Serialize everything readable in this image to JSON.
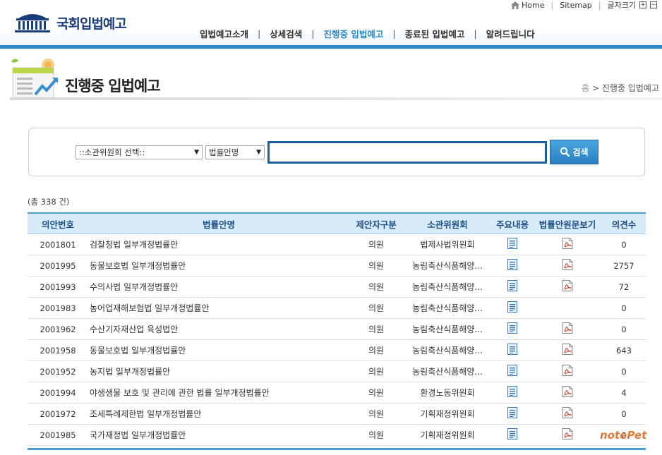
{
  "util": {
    "home": "Home",
    "sitemap": "Sitemap",
    "font_size": "글자크기",
    "plus": "+",
    "minus": "−"
  },
  "logo": {
    "text": "국회입법예고"
  },
  "nav": [
    {
      "label": "입법예고소개"
    },
    {
      "label": "상세검색"
    },
    {
      "label": "진행중 입법예고"
    },
    {
      "label": "종료된 입법예고"
    },
    {
      "label": "알려드립니다"
    }
  ],
  "page": {
    "title": "진행중 입법예고",
    "breadcrumb_home": "홈",
    "breadcrumb_sep": ">",
    "breadcrumb_current": "진행중 입법예고"
  },
  "search": {
    "committee_select": "::소관위원회 선택::",
    "field_select": "법률안명",
    "input_value": "",
    "button_label": "검색"
  },
  "count_label": "(총 338 건)",
  "table": {
    "headers": [
      "의안번호",
      "법률안명",
      "제안자구분",
      "소관위원회",
      "주요내용",
      "법률안원문보기",
      "의견수"
    ],
    "rows": [
      {
        "no": "2001801",
        "name": "검찰청법 일부개정법률안",
        "proposer": "의원",
        "committee": "법제사법위원회",
        "has_pdf": true,
        "opinions": "0"
      },
      {
        "no": "2001995",
        "name": "동물보호법 일부개정법률안",
        "proposer": "의원",
        "committee": "농림축산식품해양...",
        "has_pdf": true,
        "opinions": "2757"
      },
      {
        "no": "2001993",
        "name": "수의사법 일부개정법률안",
        "proposer": "의원",
        "committee": "농림축산식품해양...",
        "has_pdf": true,
        "opinions": "72"
      },
      {
        "no": "2001983",
        "name": "농어업재해보험법 일부개정법률안",
        "proposer": "의원",
        "committee": "농림축산식품해양...",
        "has_pdf": false,
        "opinions": "0"
      },
      {
        "no": "2001962",
        "name": "수산기자재산업 육성법안",
        "proposer": "의원",
        "committee": "농림축산식품해양...",
        "has_pdf": true,
        "opinions": "0"
      },
      {
        "no": "2001958",
        "name": "동물보호법 일부개정법률안",
        "proposer": "의원",
        "committee": "농림축산식품해양...",
        "has_pdf": true,
        "opinions": "643"
      },
      {
        "no": "2001952",
        "name": "농지법 일부개정법률안",
        "proposer": "의원",
        "committee": "농림축산식품해양...",
        "has_pdf": true,
        "opinions": "0"
      },
      {
        "no": "2001994",
        "name": "야생생물 보호 및 관리에 관한 법률 일부개정법률안",
        "proposer": "의원",
        "committee": "환경노동위원회",
        "has_pdf": true,
        "opinions": "4"
      },
      {
        "no": "2001972",
        "name": "조세특례제한법 일부개정법률안",
        "proposer": "의원",
        "committee": "기획재정위원회",
        "has_pdf": true,
        "opinions": "0"
      },
      {
        "no": "2001985",
        "name": "국가재정법 일부개정법률안",
        "proposer": "의원",
        "committee": "기획재정위원회",
        "has_pdf": true,
        "opinions": "0"
      }
    ]
  },
  "watermark": "notePet",
  "colors": {
    "brand_blue": "#2f86c8",
    "nav_active": "#2a8bc9",
    "header_bg": "#d7ebf8",
    "title_navy": "#1b3d7a"
  }
}
